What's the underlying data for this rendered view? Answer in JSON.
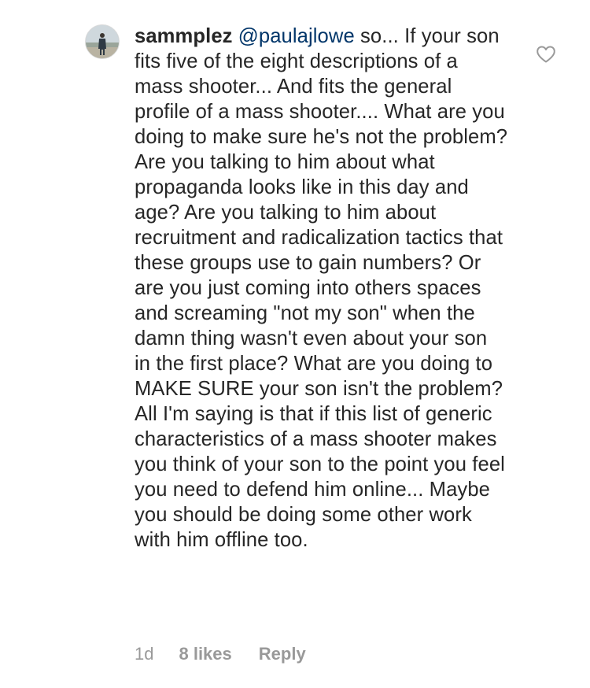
{
  "comment": {
    "username": "sammplez",
    "mention": "@paulajlowe",
    "body": " so... If your son fits five of the eight descriptions of a mass shooter... And fits the general profile of a mass shooter.... What are you doing to make sure he's not the problem? Are you talking to him about what propaganda looks like in this day and age? Are you talking to him about recruitment and radicalization tactics that these groups use to gain numbers? Or are you just coming into others spaces and screaming \"not my son\" when the damn thing wasn't even about your son in the first place? What are you doing to MAKE SURE your son isn't the problem? All I'm saying is that if this list of generic characteristics of a mass shooter makes you think of your son to the point you feel you need to defend him online... Maybe you should be doing some other work with him offline too.",
    "timestamp": "1d",
    "likes_label": "8 likes",
    "reply_label": "Reply"
  },
  "icons": {
    "avatar": "profile-photo",
    "like": "heart-outline-icon"
  },
  "colors": {
    "text": "#262626",
    "mention": "#003569",
    "meta": "#999999",
    "heart": "#999999"
  }
}
